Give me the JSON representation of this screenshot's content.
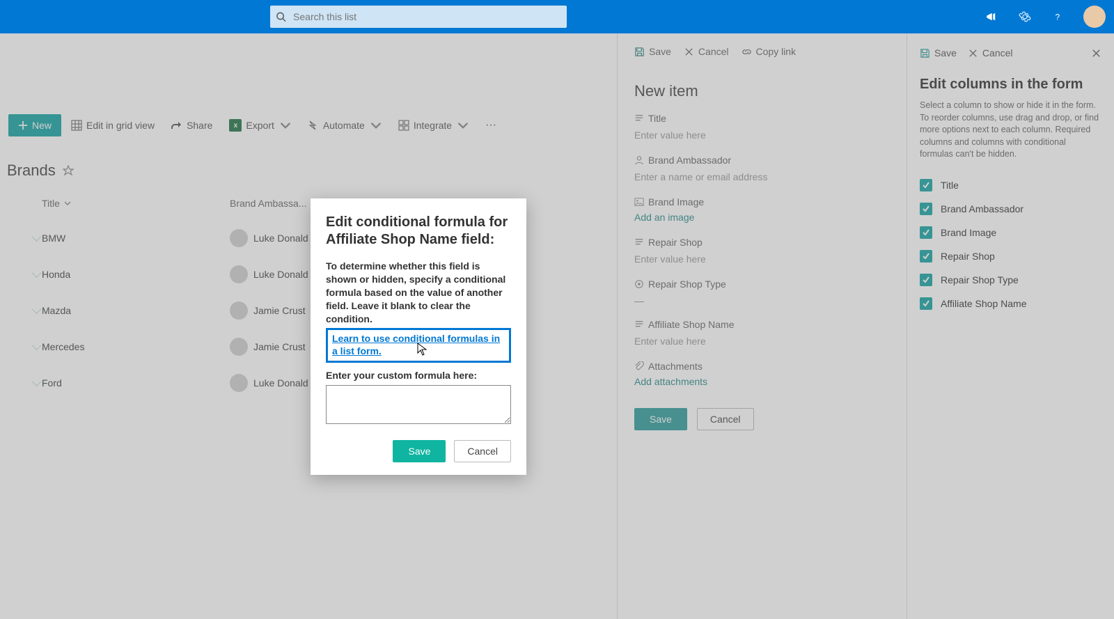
{
  "header": {
    "search_placeholder": "Search this list"
  },
  "command_bar": {
    "new": "New",
    "edit_grid": "Edit in grid view",
    "share": "Share",
    "export": "Export",
    "automate": "Automate",
    "integrate": "Integrate"
  },
  "list": {
    "title": "Brands",
    "columns": {
      "title": "Title",
      "ambassador": "Brand Ambassa..."
    },
    "rows": [
      {
        "title": "BMW",
        "ambassador": "Luke Donald"
      },
      {
        "title": "Honda",
        "ambassador": "Luke Donald"
      },
      {
        "title": "Mazda",
        "ambassador": "Jamie Crust"
      },
      {
        "title": "Mercedes",
        "ambassador": "Jamie Crust"
      },
      {
        "title": "Ford",
        "ambassador": "Luke Donald"
      }
    ]
  },
  "new_item_panel": {
    "bar": {
      "save": "Save",
      "cancel": "Cancel",
      "copy_link": "Copy link"
    },
    "title": "New item",
    "fields": {
      "title": {
        "label": "Title",
        "placeholder": "Enter value here"
      },
      "ambassador": {
        "label": "Brand Ambassador",
        "placeholder": "Enter a name or email address"
      },
      "brand_image": {
        "label": "Brand Image",
        "link": "Add an image"
      },
      "repair_shop": {
        "label": "Repair Shop",
        "placeholder": "Enter value here"
      },
      "repair_type": {
        "label": "Repair Shop Type",
        "value": "—"
      },
      "affiliate": {
        "label": "Affiliate Shop Name",
        "placeholder": "Enter value here"
      },
      "attachments": {
        "label": "Attachments",
        "link": "Add attachments"
      }
    },
    "buttons": {
      "save": "Save",
      "cancel": "Cancel"
    }
  },
  "edit_columns_panel": {
    "bar": {
      "save": "Save",
      "cancel": "Cancel"
    },
    "title": "Edit columns in the form",
    "help": "Select a column to show or hide it in the form. To reorder columns, use drag and drop, or find more options next to each column. Required columns and columns with conditional formulas can't be hidden.",
    "items": [
      "Title",
      "Brand Ambassador",
      "Brand Image",
      "Repair Shop",
      "Repair Shop Type",
      "Affiliate Shop Name"
    ]
  },
  "modal": {
    "title": "Edit conditional formula for Affiliate Shop Name field:",
    "desc": "To determine whether this field is shown or hidden, specify a conditional formula based on the value of another field. Leave it blank to clear the condition.",
    "link": "Learn to use conditional formulas in a list form.",
    "formula_label": "Enter your custom formula here:",
    "buttons": {
      "save": "Save",
      "cancel": "Cancel"
    }
  }
}
